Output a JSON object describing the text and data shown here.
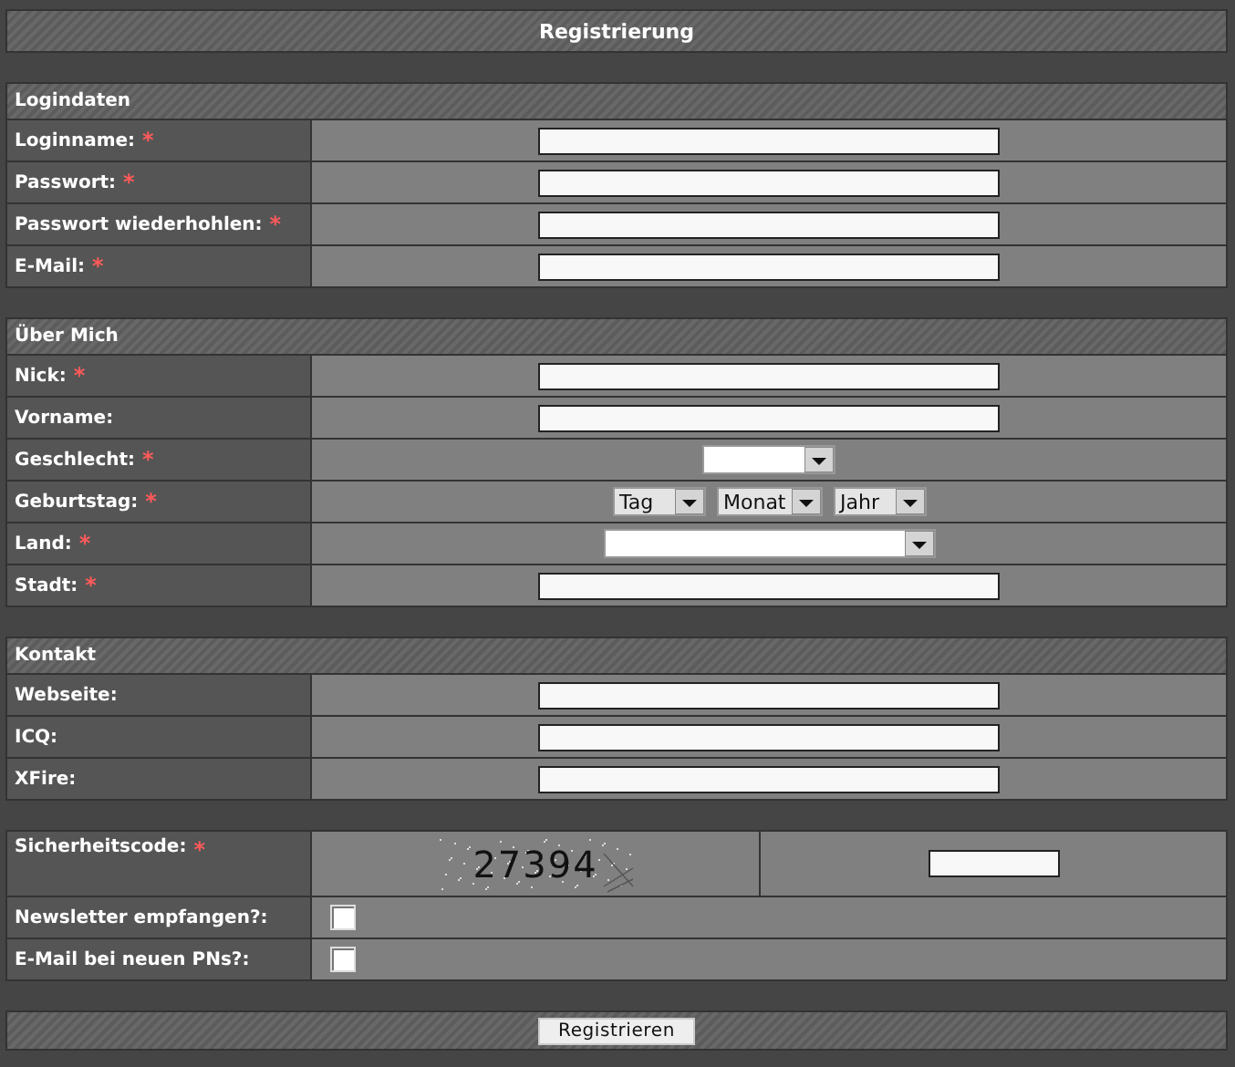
{
  "title": "Registrierung",
  "sections": [
    {
      "title": "Logindaten",
      "rows": [
        {
          "label": "Loginname:",
          "required_mark": "*",
          "kind": "text"
        },
        {
          "label": "Passwort:",
          "required_mark": "*",
          "kind": "text"
        },
        {
          "label": "Passwort wiederhohlen:",
          "required_mark": "*",
          "kind": "text"
        },
        {
          "label": "E-Mail:",
          "required_mark": "*",
          "kind": "text"
        }
      ]
    },
    {
      "title": "Über Mich",
      "rows": [
        {
          "label": "Nick:",
          "required_mark": "*",
          "kind": "text"
        },
        {
          "label": "Vorname:",
          "kind": "text"
        },
        {
          "label": "Geschlecht:",
          "required_mark": "*",
          "kind": "gender"
        },
        {
          "label": "Geburtstag:",
          "required_mark": "*",
          "kind": "date",
          "selects": [
            {
              "value": "Tag"
            },
            {
              "value": "Monat"
            },
            {
              "value": "Jahr"
            }
          ]
        },
        {
          "label": "Land:",
          "required_mark": "*",
          "kind": "country"
        },
        {
          "label": "Stadt:",
          "required_mark": "*",
          "kind": "text"
        }
      ]
    },
    {
      "title": "Kontakt",
      "rows": [
        {
          "label": "Webseite:",
          "kind": "text"
        },
        {
          "label": "ICQ:",
          "kind": "text"
        },
        {
          "label": "XFire:",
          "kind": "text"
        }
      ]
    },
    {
      "rows": [
        {
          "label": "Sicherheitscode:",
          "required_mark": "*",
          "kind": "captcha",
          "code": "27394"
        },
        {
          "label": "Newsletter empfangen?:",
          "kind": "checkbox",
          "checked": false
        },
        {
          "label": "E-Mail bei neuen PNs?:",
          "kind": "checkbox",
          "checked": false
        }
      ]
    }
  ],
  "submit": "Registrieren"
}
